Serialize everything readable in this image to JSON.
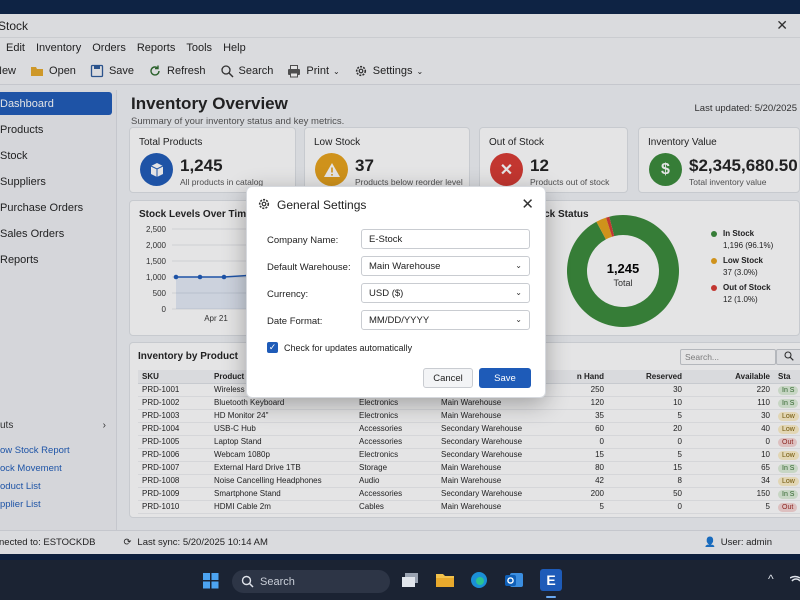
{
  "window": {
    "title": "Stock",
    "close": "✕"
  },
  "menu": [
    "Edit",
    "Inventory",
    "Orders",
    "Reports",
    "Tools",
    "Help"
  ],
  "toolbar": {
    "new": "New",
    "open": "Open",
    "save": "Save",
    "refresh": "Refresh",
    "search": "Search",
    "print": "Print",
    "settings": "Settings"
  },
  "sidebar": {
    "items": [
      "Dashboard",
      "Products",
      "Stock",
      "Suppliers",
      "Purchase Orders",
      "Sales Orders",
      "Reports"
    ],
    "shortcuts_title": "uts",
    "shortcuts": [
      "ow Stock Report",
      "ock Movement",
      "oduct List",
      "pplier List"
    ]
  },
  "header": {
    "title": "Inventory Overview",
    "subtitle": "Summary of your inventory status and key metrics.",
    "updated": "Last updated: 5/20/2025"
  },
  "kpis": [
    {
      "label": "Total Products",
      "value": "1,245",
      "sub": "All products in catalog",
      "color": "#1e5bb8",
      "icon": "box-icon"
    },
    {
      "label": "Low Stock",
      "value": "37",
      "sub": "Products below reorder level",
      "color": "#e8a21a",
      "icon": "warning-icon"
    },
    {
      "label": "Out of Stock",
      "value": "12",
      "sub": "Products out of stock",
      "color": "#d93a32",
      "icon": "x-icon"
    },
    {
      "label": "Inventory Value",
      "value": "$2,345,680.50",
      "sub": "Total inventory value",
      "color": "#3a8a3a",
      "icon": "dollar-icon"
    }
  ],
  "line_chart": {
    "title": "Stock Levels Over Time",
    "yticks": [
      "2,500",
      "2,000",
      "1,500",
      "1,000",
      "500",
      "0"
    ],
    "xtick": "Apr 21"
  },
  "donut": {
    "title": "ock Status",
    "center_value": "1,245",
    "center_label": "Total",
    "legend": [
      {
        "name": "In Stock",
        "detail": "1,196 (96.1%)",
        "color": "#3a8a3a"
      },
      {
        "name": "Low Stock",
        "detail": "37 (3.0%)",
        "color": "#e8a21a"
      },
      {
        "name": "Out of Stock",
        "detail": "12 (1.0%)",
        "color": "#d93a32"
      }
    ]
  },
  "chart_data": [
    {
      "type": "line",
      "title": "Stock Levels Over Time",
      "ylim": [
        0,
        2500
      ],
      "x": [
        "Apr 21"
      ],
      "values": [
        1000,
        1000,
        1000,
        1050,
        1150
      ]
    },
    {
      "type": "pie",
      "title": "ock Status",
      "categories": [
        "In Stock",
        "Low Stock",
        "Out of Stock"
      ],
      "values": [
        1196,
        37,
        12
      ]
    }
  ],
  "inventory": {
    "title": "Inventory by Product",
    "search_placeholder": "Search...",
    "columns": [
      "SKU",
      "Product",
      "",
      "",
      "n Hand",
      "Reserved",
      "Available",
      "Sta"
    ],
    "rows": [
      [
        "PRD-1001",
        "Wireless Mo",
        "",
        "",
        "250",
        "30",
        "220",
        "In S"
      ],
      [
        "PRD-1002",
        "Bluetooth Keyboard",
        "Electronics",
        "Main Warehouse",
        "120",
        "10",
        "110",
        "In S"
      ],
      [
        "PRD-1003",
        "HD Monitor 24\"",
        "Electronics",
        "Main Warehouse",
        "35",
        "5",
        "30",
        "Low"
      ],
      [
        "PRD-1004",
        "USB-C Hub",
        "Accessories",
        "Secondary Warehouse",
        "60",
        "20",
        "40",
        "Low"
      ],
      [
        "PRD-1005",
        "Laptop Stand",
        "Accessories",
        "Secondary Warehouse",
        "0",
        "0",
        "0",
        "Out"
      ],
      [
        "PRD-1006",
        "Webcam 1080p",
        "Electronics",
        "Secondary Warehouse",
        "15",
        "5",
        "10",
        "Low"
      ],
      [
        "PRD-1007",
        "External Hard Drive 1TB",
        "Storage",
        "Main Warehouse",
        "80",
        "15",
        "65",
        "In S"
      ],
      [
        "PRD-1008",
        "Noise Cancelling Headphones",
        "Audio",
        "Main Warehouse",
        "42",
        "8",
        "34",
        "Low"
      ],
      [
        "PRD-1009",
        "Smartphone Stand",
        "Accessories",
        "Secondary Warehouse",
        "200",
        "50",
        "150",
        "In S"
      ],
      [
        "PRD-1010",
        "HDMI Cable 2m",
        "Cables",
        "Main Warehouse",
        "5",
        "0",
        "5",
        "Out"
      ]
    ]
  },
  "status": {
    "connected": "nected to: ESTOCKDB",
    "sync": "Last sync: 5/20/2025 10:14 AM",
    "user": "User: admin"
  },
  "dialog": {
    "title": "General Settings",
    "close": "✕",
    "fields": [
      {
        "label": "Company Name:",
        "value": "E-Stock",
        "type": "text"
      },
      {
        "label": "Default Warehouse:",
        "value": "Main Warehouse",
        "type": "select"
      },
      {
        "label": "Currency:",
        "value": "USD ($)",
        "type": "select"
      },
      {
        "label": "Date Format:",
        "value": "MM/DD/YYYY",
        "type": "select"
      }
    ],
    "checkbox_label": "Check for updates automatically",
    "cancel": "Cancel",
    "save": "Save"
  },
  "taskbar": {
    "search": "Search"
  }
}
